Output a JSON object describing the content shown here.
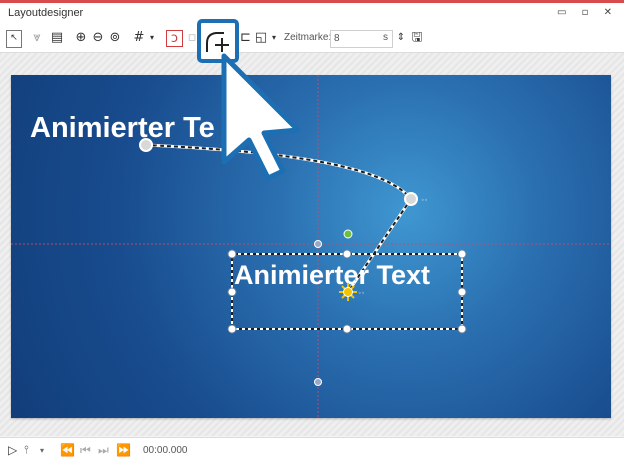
{
  "window": {
    "title": "Layoutdesigner"
  },
  "toolbar": {
    "timemark_label": "Zeitmarke:",
    "timemark_value": "8",
    "timemark_unit": "s"
  },
  "stage": {
    "text_start": "Animierter Te",
    "text_main": "Animierter Text"
  },
  "playback": {
    "time": "00:00.000"
  },
  "colors": {
    "accent": "#1c6fb3",
    "stage_dark": "#123e7a",
    "stage_light": "#3f97d1",
    "highlight_box": "#1c6fb3",
    "topline": "#d94b4b"
  }
}
